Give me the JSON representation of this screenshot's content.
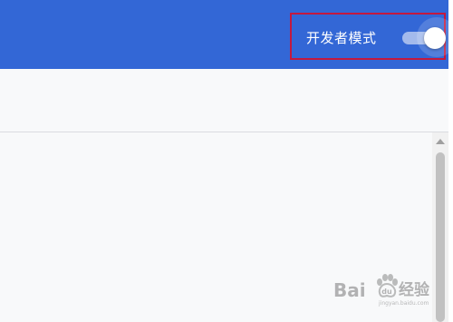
{
  "header": {
    "developer_mode_label": "开发者模式",
    "developer_mode_enabled": true
  },
  "watermark": {
    "brand_left": "Bai",
    "brand_right": "经验",
    "brand_mid": "du",
    "url": "jingyan.baidu.com"
  },
  "colors": {
    "header_bg": "#3367d6",
    "highlight_border": "#c3193f",
    "page_bg": "#f8f9fa",
    "scrollbar_thumb": "#c1c1c1"
  }
}
